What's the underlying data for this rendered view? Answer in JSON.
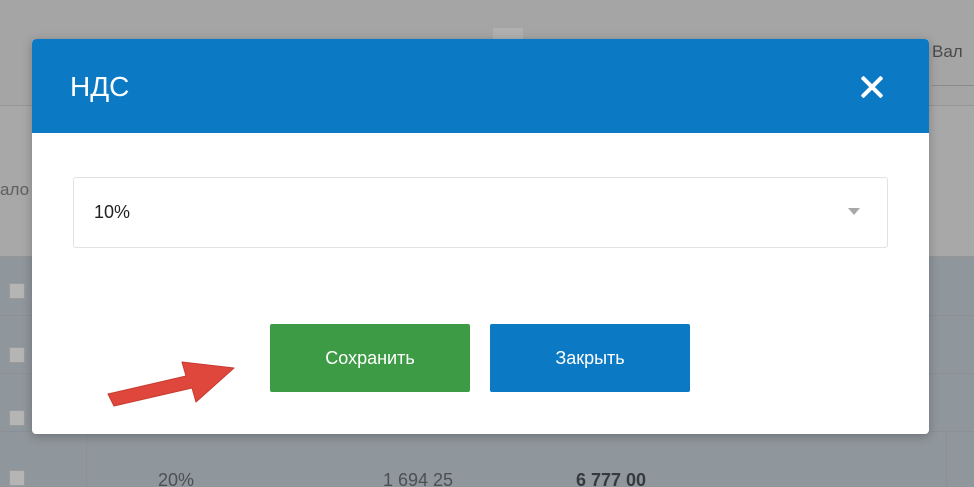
{
  "background": {
    "left_fragment": "ало",
    "right_fragment": "Вал",
    "bottom_row": {
      "percent": "20%",
      "amount": "1 694 25",
      "total": "6 777 00"
    }
  },
  "modal": {
    "title": "НДС",
    "close_icon": "close-icon",
    "select": {
      "value": "10%",
      "icon": "chevron-down-icon"
    },
    "save_label": "Сохранить",
    "close_label": "Закрыть",
    "colors": {
      "header": "#0b79c3",
      "save": "#3e9b45",
      "close": "#0b79c3",
      "arrow": "#e0473c"
    }
  }
}
